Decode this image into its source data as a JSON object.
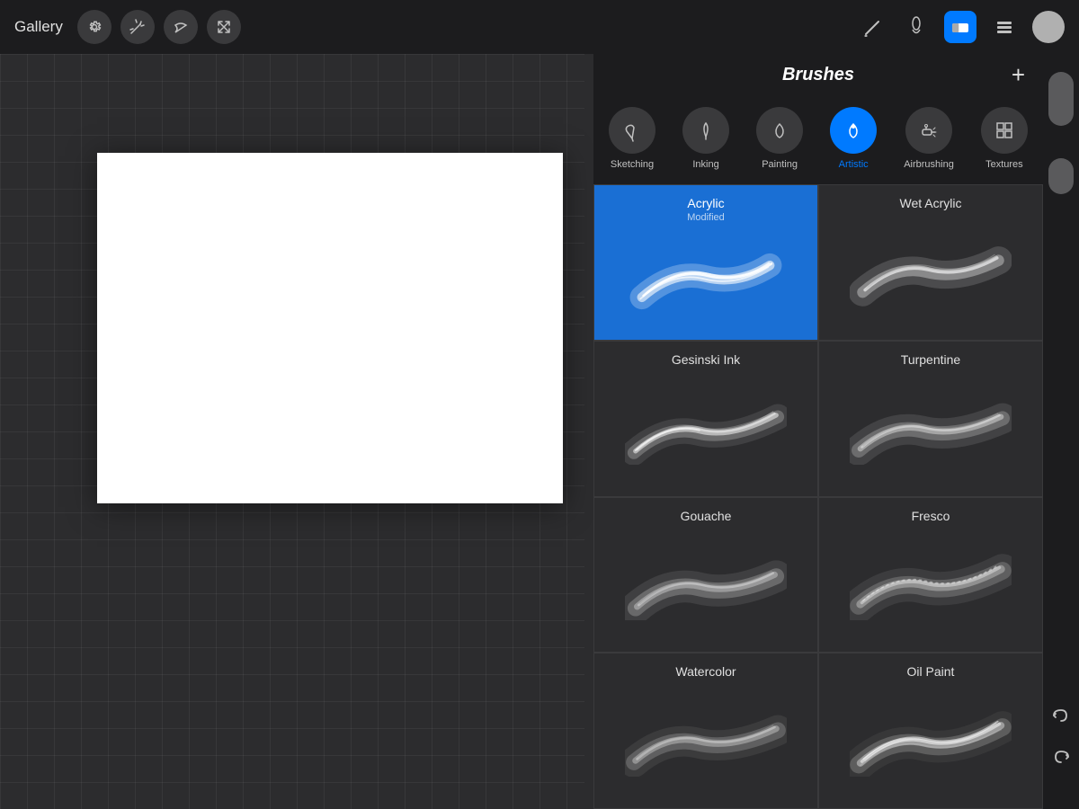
{
  "toolbar": {
    "gallery_label": "Gallery",
    "add_label": "+"
  },
  "brushes_panel": {
    "title": "Brushes",
    "categories": [
      {
        "id": "sketching",
        "label": "Sketching",
        "active": false,
        "icon": "pencil"
      },
      {
        "id": "inking",
        "label": "Inking",
        "active": false,
        "icon": "pen"
      },
      {
        "id": "painting",
        "label": "Painting",
        "active": false,
        "icon": "drop"
      },
      {
        "id": "artistic",
        "label": "Artistic",
        "active": true,
        "icon": "star"
      },
      {
        "id": "airbrushing",
        "label": "Airbrushing",
        "active": false,
        "icon": "spray"
      },
      {
        "id": "textures",
        "label": "Textures",
        "active": false,
        "icon": "grid"
      }
    ],
    "brushes": [
      {
        "name": "Acrylic",
        "subtitle": "Modified",
        "selected": true,
        "col": 0
      },
      {
        "name": "Wet Acrylic",
        "subtitle": "",
        "selected": false,
        "col": 1
      },
      {
        "name": "Gesinski Ink",
        "subtitle": "",
        "selected": false,
        "col": 0
      },
      {
        "name": "Turpentine",
        "subtitle": "",
        "selected": false,
        "col": 1
      },
      {
        "name": "Gouache",
        "subtitle": "",
        "selected": false,
        "col": 0
      },
      {
        "name": "Fresco",
        "subtitle": "",
        "selected": false,
        "col": 1
      },
      {
        "name": "Watercolor",
        "subtitle": "",
        "selected": false,
        "col": 0
      },
      {
        "name": "Oil Paint",
        "subtitle": "",
        "selected": false,
        "col": 1
      }
    ]
  }
}
